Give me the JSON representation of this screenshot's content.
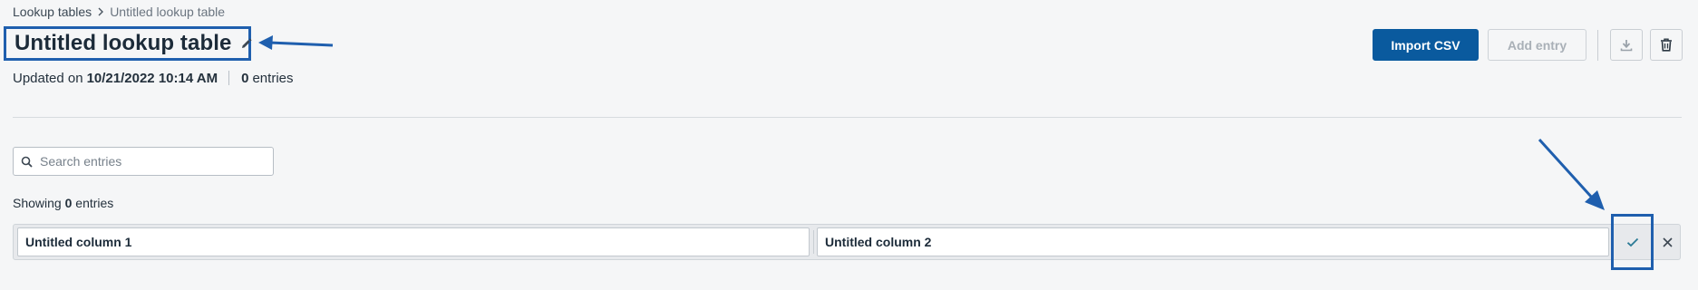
{
  "breadcrumb": {
    "parent": "Lookup tables",
    "current": "Untitled lookup table"
  },
  "header": {
    "title": "Untitled lookup table",
    "updated_prefix": "Updated on",
    "updated_value": "10/21/2022 10:14 AM",
    "entries_count": "0",
    "entries_label": "entries"
  },
  "toolbar": {
    "import_label": "Import CSV",
    "add_entry_label": "Add entry",
    "download_icon": "download-icon",
    "delete_icon": "trash-icon"
  },
  "search": {
    "placeholder": "Search entries",
    "value": ""
  },
  "list": {
    "showing_prefix": "Showing",
    "showing_count": "0",
    "showing_suffix": "entries"
  },
  "columns": {
    "col1_value": "Untitled column 1",
    "col2_value": "Untitled column 2"
  },
  "colors": {
    "primary": "#0a5a9e",
    "annotation": "#1f5fae",
    "background": "#f5f6f7"
  }
}
